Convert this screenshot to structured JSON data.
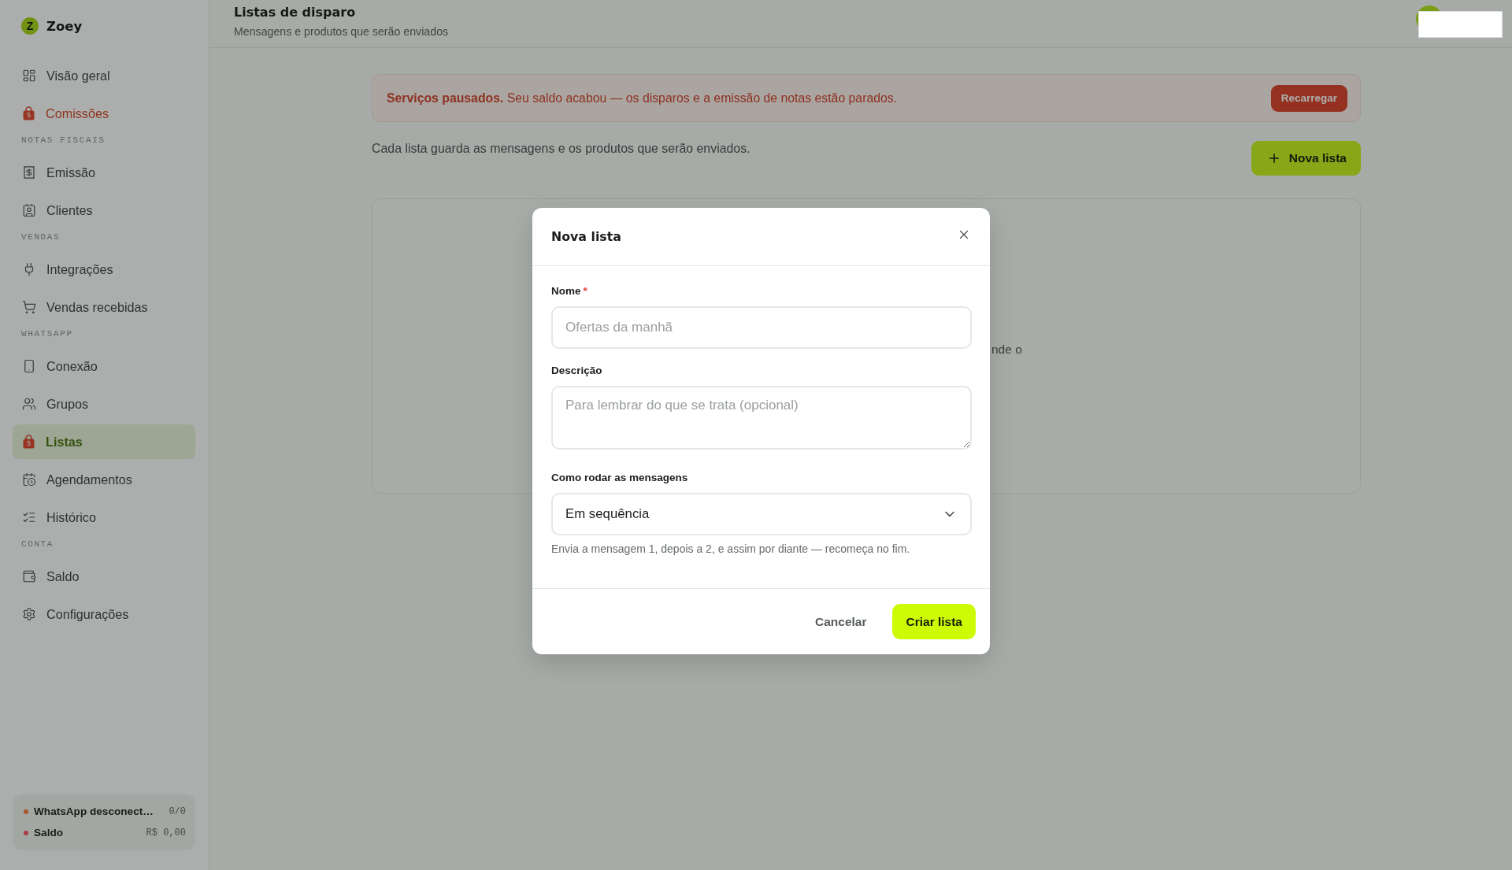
{
  "sidebar": {
    "brand": {
      "mark": "Z",
      "name": "Zoey"
    },
    "sections": [
      {
        "items": [
          {
            "label": "Visão geral",
            "selected": false,
            "highlighted": false
          },
          {
            "label": "Comissões",
            "selected": false,
            "highlighted": true
          }
        ]
      },
      {
        "title": "NOTAS FISCAIS",
        "items": [
          {
            "label": "Emissão",
            "selected": false,
            "highlighted": false
          },
          {
            "label": "Clientes",
            "selected": false,
            "highlighted": false
          }
        ]
      },
      {
        "title": "VENDAS",
        "items": [
          {
            "label": "Integrações",
            "selected": false,
            "highlighted": false
          },
          {
            "label": "Vendas recebidas",
            "selected": false,
            "highlighted": false
          }
        ]
      },
      {
        "title": "WHATSAPP",
        "items": [
          {
            "label": "Conexão",
            "selected": false,
            "highlighted": false
          },
          {
            "label": "Grupos",
            "selected": false,
            "highlighted": false
          },
          {
            "label": "Listas",
            "selected": true,
            "highlighted": false
          },
          {
            "label": "Agendamentos",
            "selected": false,
            "highlighted": false
          },
          {
            "label": "Histórico",
            "selected": false,
            "highlighted": false
          }
        ]
      },
      {
        "title": "CONTA",
        "items": [
          {
            "label": "Saldo",
            "selected": false,
            "highlighted": false
          },
          {
            "label": "Configurações",
            "selected": false,
            "highlighted": false
          }
        ]
      }
    ],
    "status": [
      {
        "label": "WhatsApp desconect…",
        "value": "0/0",
        "color": "#a9572f"
      },
      {
        "label": "Saldo",
        "value": "R$ 0,00",
        "color": "#a83d48"
      }
    ]
  },
  "header": {
    "title": "Listas de disparo",
    "subtitle": "Mensagens e produtos que serão enviados"
  },
  "banner": {
    "text": "**Serviços pausados.** Seu saldo acabou — os disparos e a emissão de notas estão parados.",
    "button": "Recarregar"
  },
  "intro": "Cada lista guarda as mensagens e os produtos que serão enviados.",
  "new_list_button": "Nova lista",
  "card": {
    "text": "nde o"
  },
  "modal": {
    "title": "Nova lista",
    "fields": [
      {
        "kind": "input",
        "label": "Nome",
        "required_mark": "*",
        "placeholder": "Ofertas da manhã"
      },
      {
        "kind": "textarea",
        "label": "Descrição",
        "placeholder": "Para lembrar do que se trata (opcional)"
      },
      {
        "kind": "select",
        "label": "Como rodar as mensagens",
        "value": "Em sequência",
        "hint": "Envia a mensagem 1, depois a 2, e assim por diante — recomeça no fim."
      }
    ],
    "buttons": [
      {
        "kind": "secondary",
        "label": "Cancelar"
      },
      {
        "kind": "primary",
        "label": "Criar lista"
      }
    ]
  }
}
